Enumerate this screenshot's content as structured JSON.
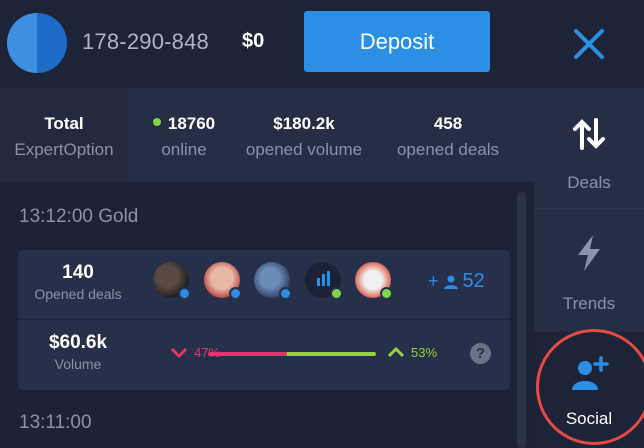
{
  "header": {
    "account_id": "178-290-848",
    "balance": "$0",
    "deposit_label": "Deposit"
  },
  "stats": {
    "total_title": "Total",
    "total_sub": "ExpertOption",
    "online_value": "18760",
    "online_label": "online",
    "volume_value": "$180.2k",
    "volume_label": "opened volume",
    "deals_value": "458",
    "deals_label": "opened deals"
  },
  "feed": {
    "first_time": "13:12:00 Gold",
    "card": {
      "opened_deals_value": "140",
      "opened_deals_label": "Opened deals",
      "followers_count": "52",
      "volume_value": "$60.6k",
      "volume_label": "Volume",
      "down_pct": "47%",
      "up_pct": "53%",
      "down_fraction": 0.47,
      "up_fraction": 0.53,
      "help_glyph": "?"
    },
    "second_time": "13:11:00"
  },
  "sidebar": {
    "deals_label": "Deals",
    "trends_label": "Trends",
    "social_label": "Social"
  },
  "colors": {
    "accent": "#2b8fe6",
    "down": "#e6336a",
    "up": "#9ccf3d",
    "highlight_ring": "#e54a44",
    "online_dot": "#7fd64a"
  }
}
